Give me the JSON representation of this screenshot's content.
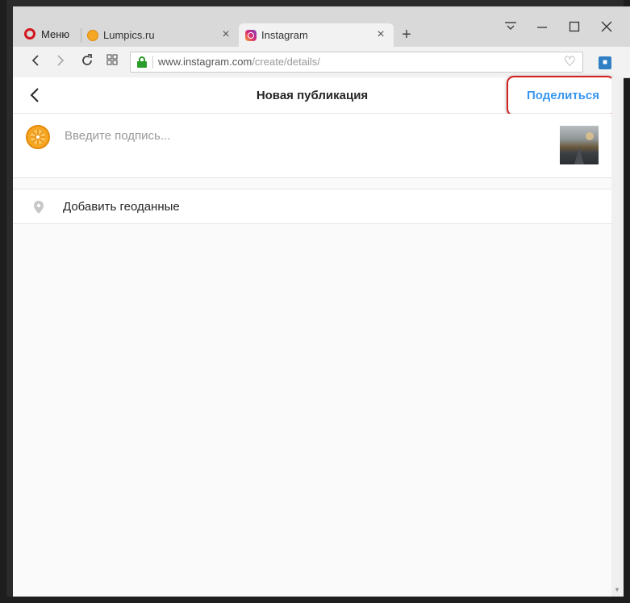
{
  "browser": {
    "menu_label": "Меню",
    "tabs": [
      {
        "title": "Lumpics.ru",
        "icon": "lumpics-favicon",
        "active": false
      },
      {
        "title": "Instagram",
        "icon": "instagram-favicon",
        "active": true
      }
    ],
    "url_host": "www.instagram.com",
    "url_path": "/create/details/"
  },
  "page": {
    "title": "Новая публикация",
    "share_label": "Поделиться",
    "caption_placeholder": "Введите подпись...",
    "geo_label": "Добавить геоданные"
  },
  "colors": {
    "accent": "#3897f0",
    "highlight": "#d21f1f",
    "opera_red": "#d3161d",
    "lock_green": "#2a9d2a"
  }
}
